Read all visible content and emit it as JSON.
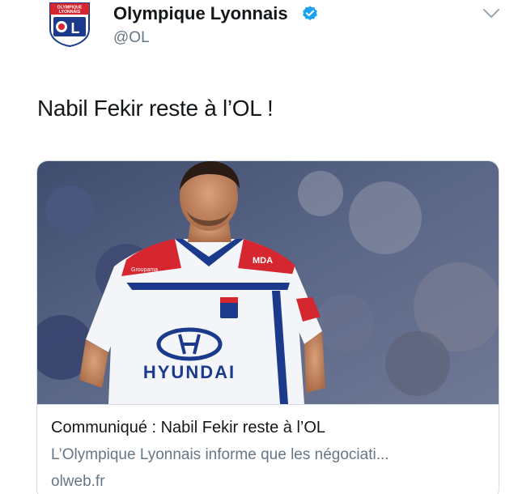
{
  "tweet": {
    "author": {
      "name": "Olympique Lyonnais",
      "handle": "@OL",
      "avatar_icon": "ol-crest-icon",
      "avatar_text_top": "OLYMPIQUE LYONNAIS",
      "avatar_text_main": "OL",
      "verified_icon": "verified-badge-icon"
    },
    "menu_icon": "chevron-down-icon",
    "text": "Nabil Fekir reste à l’OL !",
    "card": {
      "image_icon": "player-photo",
      "shirt_sponsor": "HYUNDAI",
      "shirt_brand": "MDA",
      "shirt_sleeve": "Groupama",
      "title": "Communiqué : Nabil Fekir reste à l’OL",
      "description": "L’Olympique Lyonnais informe que les négociati...",
      "domain": "olweb.fr"
    }
  },
  "colors": {
    "verified_blue": "#1da1f2",
    "ol_blue": "#1b3a8c",
    "ol_red": "#d6262f",
    "muted_text": "#657786",
    "border": "#d6dde3"
  }
}
